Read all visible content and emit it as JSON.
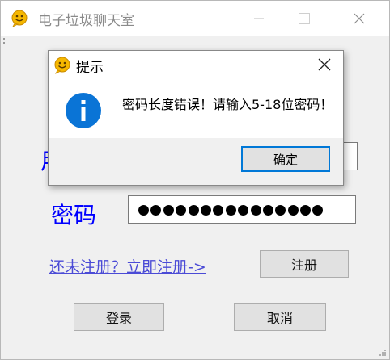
{
  "window": {
    "title": "电子垃圾聊天室",
    "icon": "smiley-chat-icon",
    "controls": [
      "minimize-icon",
      "maximize-icon",
      "close-icon"
    ]
  },
  "form": {
    "username_label_partial": "用",
    "password_label": "密码",
    "password_mask_count": 15,
    "register_link": "还未注册？立即注册->",
    "register_button": "注册",
    "login_button": "登录",
    "cancel_button": "取消"
  },
  "dialog": {
    "title": "提示",
    "icon": "info-icon",
    "message": "密码长度错误！请输入5-18位密码！",
    "ok_button": "确定"
  },
  "colors": {
    "label_blue": "#0000ff",
    "link_blue": "#4b4bd6",
    "info_blue": "#0a74d6",
    "focus_border": "#0078d7"
  }
}
